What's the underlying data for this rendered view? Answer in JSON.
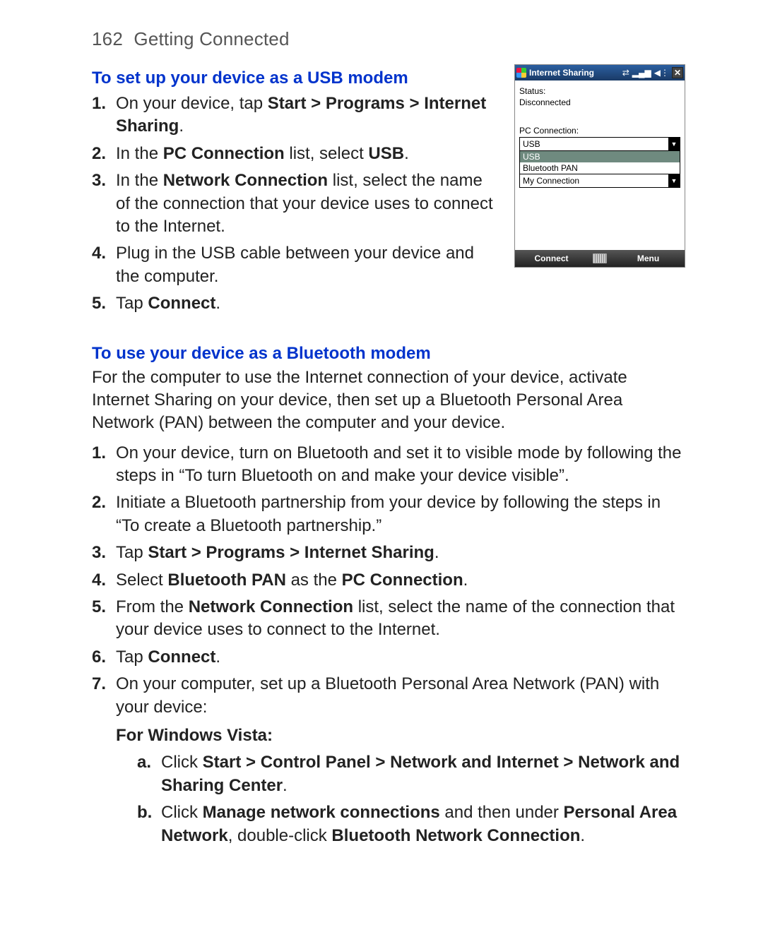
{
  "pageNumber": "162",
  "pageTitle": "Getting Connected",
  "section1": {
    "title": "To set up your device as a USB modem",
    "steps": [
      {
        "n": "1.",
        "pre": "On your device, tap ",
        "bold": "Start > Programs > Internet Sharing",
        "post": "."
      },
      {
        "n": "2.",
        "pre": "In the ",
        "bold": "PC Connection",
        "post": " list, select ",
        "bold2": "USB",
        "post2": "."
      },
      {
        "n": "3.",
        "pre": "In the ",
        "bold": "Network Connection",
        "post": " list, select the name of the connection that your device uses to connect to the Internet."
      },
      {
        "n": "4.",
        "pre": "Plug in the USB cable between your device and the computer."
      },
      {
        "n": "5.",
        "pre": "Tap ",
        "bold": "Connect",
        "post": "."
      }
    ]
  },
  "device": {
    "title": "Internet Sharing",
    "statusLabel": "Status:",
    "statusValue": "Disconnected",
    "pcConnLabel": "PC Connection:",
    "pcConnValue": "USB",
    "options": [
      "USB",
      "Bluetooth PAN"
    ],
    "netConnValue": "My Connection",
    "footerLeft": "Connect",
    "footerRight": "Menu"
  },
  "section2": {
    "title": "To use your device as a Bluetooth modem",
    "intro": "For the computer to use the Internet connection of your device, activate Internet Sharing on your device, then set up a Bluetooth Personal Area Network (PAN) between the computer and your device.",
    "steps": [
      {
        "n": "1.",
        "pre": "On your device, turn on Bluetooth and set it to visible mode by following the steps in “To turn Bluetooth on and make your device visible”."
      },
      {
        "n": "2.",
        "pre": "Initiate a Bluetooth partnership from your device by following the steps in “To create a Bluetooth partnership.”"
      },
      {
        "n": "3.",
        "pre": "Tap ",
        "bold": "Start > Programs > Internet Sharing",
        "post": "."
      },
      {
        "n": "4.",
        "pre": "Select ",
        "bold": "Bluetooth PAN",
        "post": " as the ",
        "bold2": "PC Connection",
        "post2": "."
      },
      {
        "n": "5.",
        "pre": "From the ",
        "bold": "Network Connection",
        "post": " list, select the name of the connection that your device uses to connect to the Internet."
      },
      {
        "n": "6.",
        "pre": "Tap ",
        "bold": "Connect",
        "post": "."
      },
      {
        "n": "7.",
        "pre": "On your computer, set up a Bluetooth Personal Area Network (PAN) with your device:"
      }
    ],
    "vista": {
      "heading": "For Windows Vista:",
      "a": {
        "n": "a.",
        "pre": "Click ",
        "bold": "Start > Control Panel > Network and Internet > Network and Sharing Center",
        "post": "."
      },
      "b": {
        "n": "b.",
        "pre": "Click ",
        "bold": "Manage network connections",
        "post": " and then under ",
        "bold2": "Personal Area Network",
        "post2": ", double-click ",
        "bold3": "Bluetooth Network Connection",
        "post3": "."
      }
    }
  }
}
